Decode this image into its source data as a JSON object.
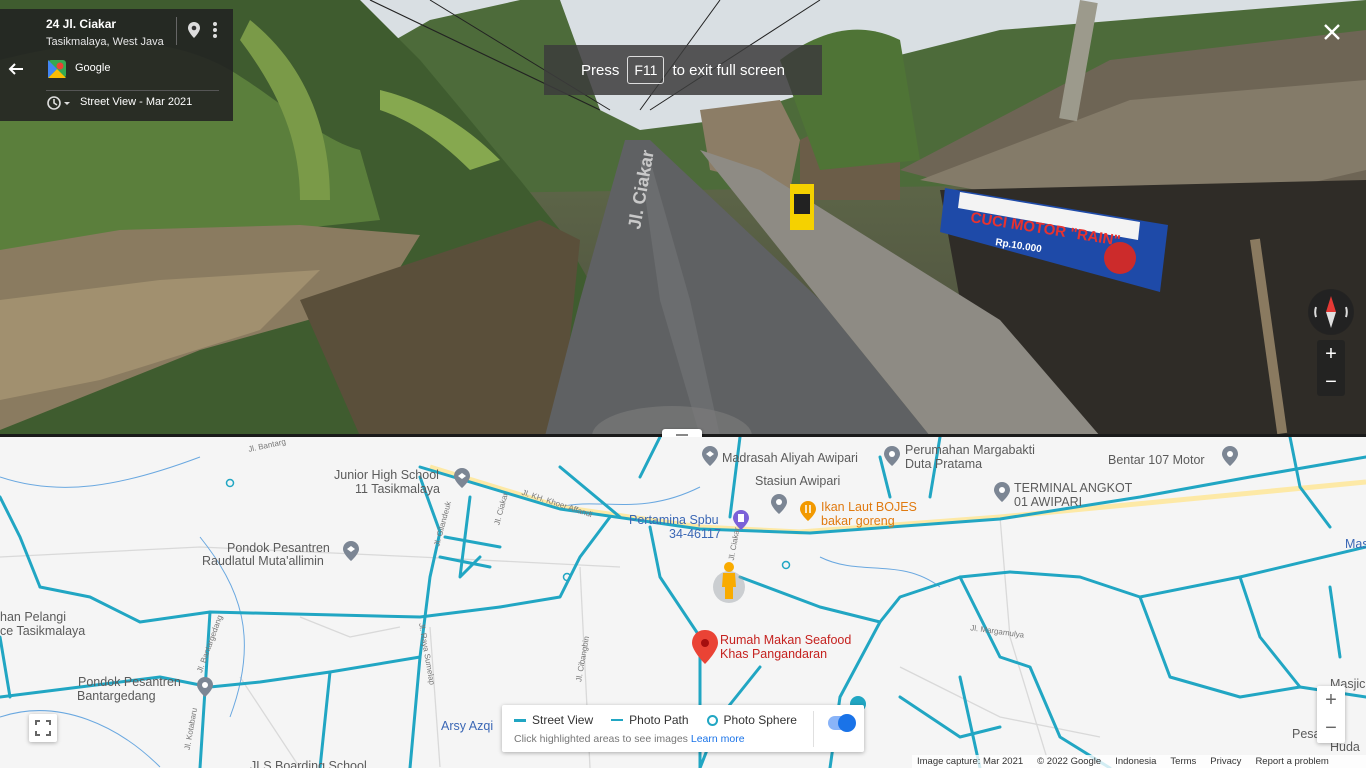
{
  "info_card": {
    "title": "24 Jl. Ciakar",
    "subtitle": "Tasikmalaya, West Java",
    "brand": "Google",
    "capture": "Street View - Mar 2021"
  },
  "fullscreen_banner": {
    "press": "Press",
    "key": "F11",
    "suffix": "to exit full screen"
  },
  "street_view": {
    "road_marking": "Jl. Ciakar",
    "shop_sign_title": "CUCI MOTOR \"RAIN\"",
    "shop_sign_price": "Rp.10.000"
  },
  "map": {
    "labels": {
      "madrasah": "Madrasah Aliyah Awipari",
      "perumahan_1": "Perumahan Margabakti",
      "perumahan_2": "Duta Pratama",
      "bentar": "Bentar 107 Motor",
      "smp_1": "Junior High School",
      "smp_2": "11 Tasikmalaya",
      "stasiun": "Stasiun Awipari",
      "terminal_1": "TERMINAL ANGKOT",
      "terminal_2": "01 AWIPARI",
      "pertamina_1": "Pertamina Spbu",
      "pertamina_2": "34-46117",
      "ikan_1": "Ikan Laut BOJES",
      "ikan_2": "bakar goreng",
      "pondok1_1": "Pondok Pesantren",
      "pondok1_2": "Raudlatul Muta'allimin",
      "pelangi_1": "han Pelangi",
      "pelangi_2": "ce Tasikmalaya",
      "rumah_1": "Rumah Makan Seafood",
      "rumah_2": "Khas Pangandaran",
      "pondok2_1": "Pondok Pesantren",
      "pondok2_2": "Bantargedang",
      "arsy": "Arsy Azqi",
      "boarding": "JLS Boarding School",
      "masjid_top": "Mas",
      "masjid_side": "Masjic",
      "pesan_1": "Pesan M",
      "pesan_2": "Huda"
    },
    "road_labels": {
      "bantarg": "Jl. Bantarg",
      "khoer": "Jl. KH. Khoer Affandi",
      "gilandeuk": "Jl. Gilandeuk",
      "ciakar": "Jl. Ciakar",
      "ciakar2": "Jl. Ciakar",
      "sumelap": "Jl. Raya Sumelap",
      "cibangbin": "Jl. Cibangbin",
      "margamulya": "Jl. Margamulya",
      "bantargedang": "Jl. Bantargedang",
      "kotabaru": "Jl. Kotabaru"
    },
    "legend": {
      "street_view": "Street View",
      "photo_path": "Photo Path",
      "photo_sphere": "Photo Sphere",
      "hint": "Click highlighted areas to see images",
      "learn_more": "Learn more",
      "toggle_on": true
    },
    "footer": {
      "capture": "Image capture: Mar 2021",
      "copyright": "© 2022 Google",
      "region": "Indonesia",
      "terms": "Terms",
      "privacy": "Privacy",
      "report": "Report a problem"
    },
    "colors": {
      "coverage": "#21a6c3",
      "pin_red": "#ea4335",
      "accent_blue": "#1a73e8",
      "pegman": "#f9ab00"
    }
  },
  "icons": {
    "back": "back-arrow-icon",
    "location": "location-pin-icon",
    "menu": "more-vert-icon",
    "history": "history-icon",
    "close": "close-icon",
    "compass": "compass-icon",
    "expand": "expand-icon"
  }
}
